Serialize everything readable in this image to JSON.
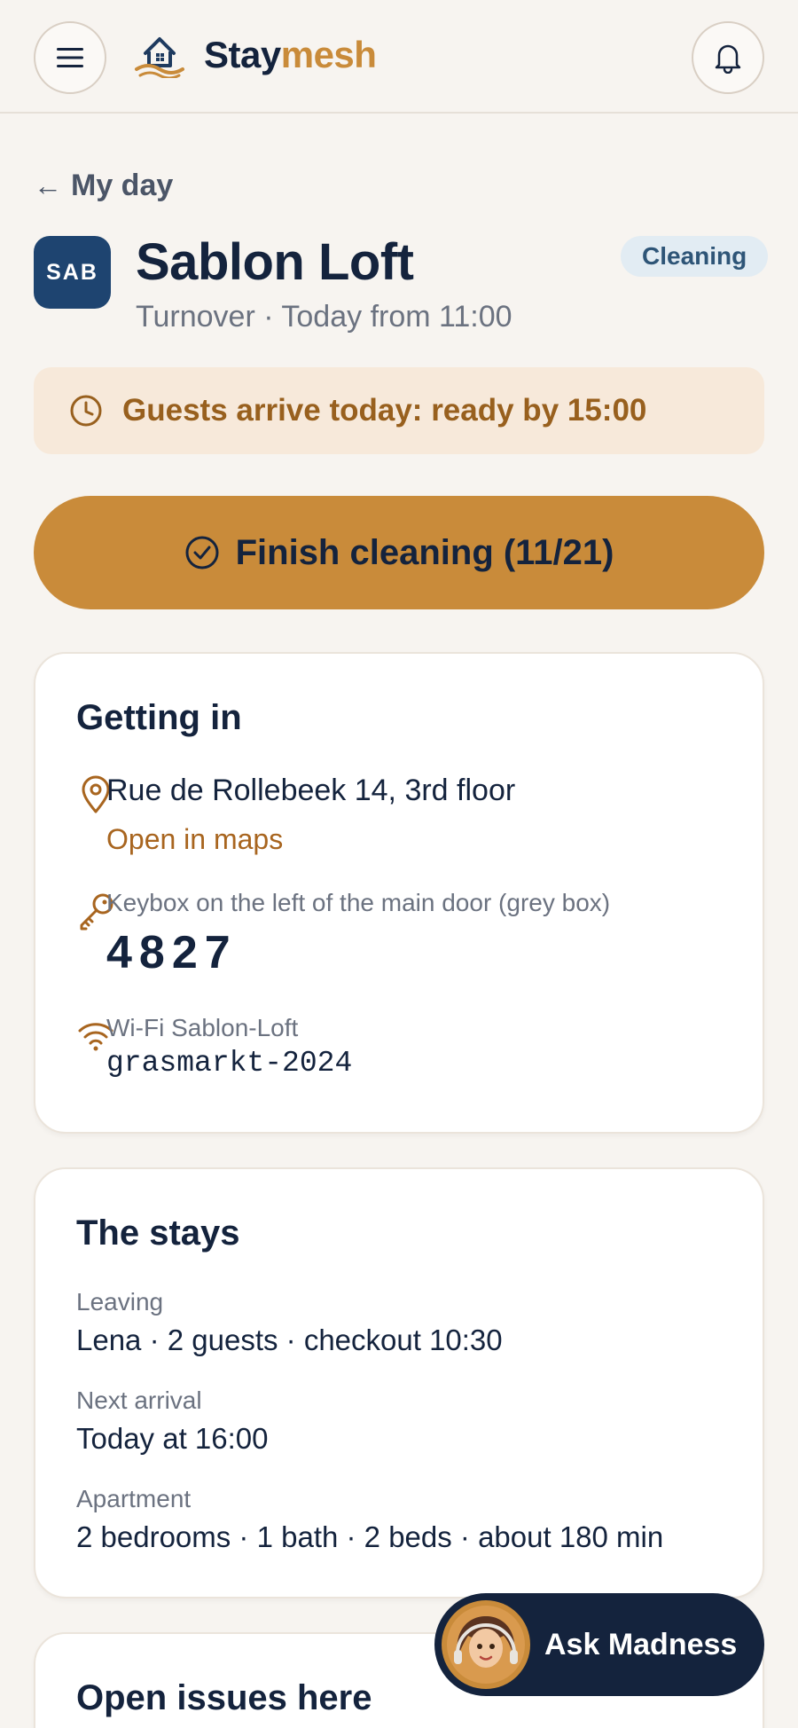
{
  "header": {
    "brand_part1": "Stay",
    "brand_part2": "mesh",
    "menu_icon": "hamburger-menu-icon",
    "logo_icon": "house-logo-icon",
    "bell_icon": "bell-icon"
  },
  "back": {
    "arrow": "←",
    "label": "My day"
  },
  "property": {
    "code": "SAB",
    "name": "Sablon Loft",
    "subtitle": "Turnover · Today from 11:00",
    "status": "Cleaning"
  },
  "alert": {
    "icon": "clock-icon",
    "text": "Guests arrive today: ready by 15:00"
  },
  "primary_action": {
    "icon": "check-circle-icon",
    "label": "Finish cleaning (11/21)"
  },
  "getting_in": {
    "title": "Getting in",
    "address": "Rue de Rollebeek 14, 3rd floor",
    "maps_link": "Open in maps",
    "keybox_label": "Keybox on the left of the main door (grey box)",
    "keybox_code": "4827",
    "wifi_label": "Wi-Fi Sablon-Loft",
    "wifi_password": "grasmarkt-2024"
  },
  "stays": {
    "title": "The stays",
    "leaving_label": "Leaving",
    "leaving_value": "Lena · 2 guests · checkout 10:30",
    "arrival_label": "Next arrival",
    "arrival_value": "Today at 16:00",
    "apartment_label": "Apartment",
    "apartment_value": "2 bedrooms · 1 bath · 2 beds · about 180 min"
  },
  "issues": {
    "title": "Open issues here"
  },
  "assistant": {
    "label": "Ask Madness",
    "avatar_icon": "assistant-avatar-icon"
  },
  "colors": {
    "accent": "#c98b3a",
    "navy": "#14233d",
    "avatar_bg": "#1e4470",
    "alert_bg": "#f7e9da",
    "pill_bg": "#e2ecf3"
  }
}
